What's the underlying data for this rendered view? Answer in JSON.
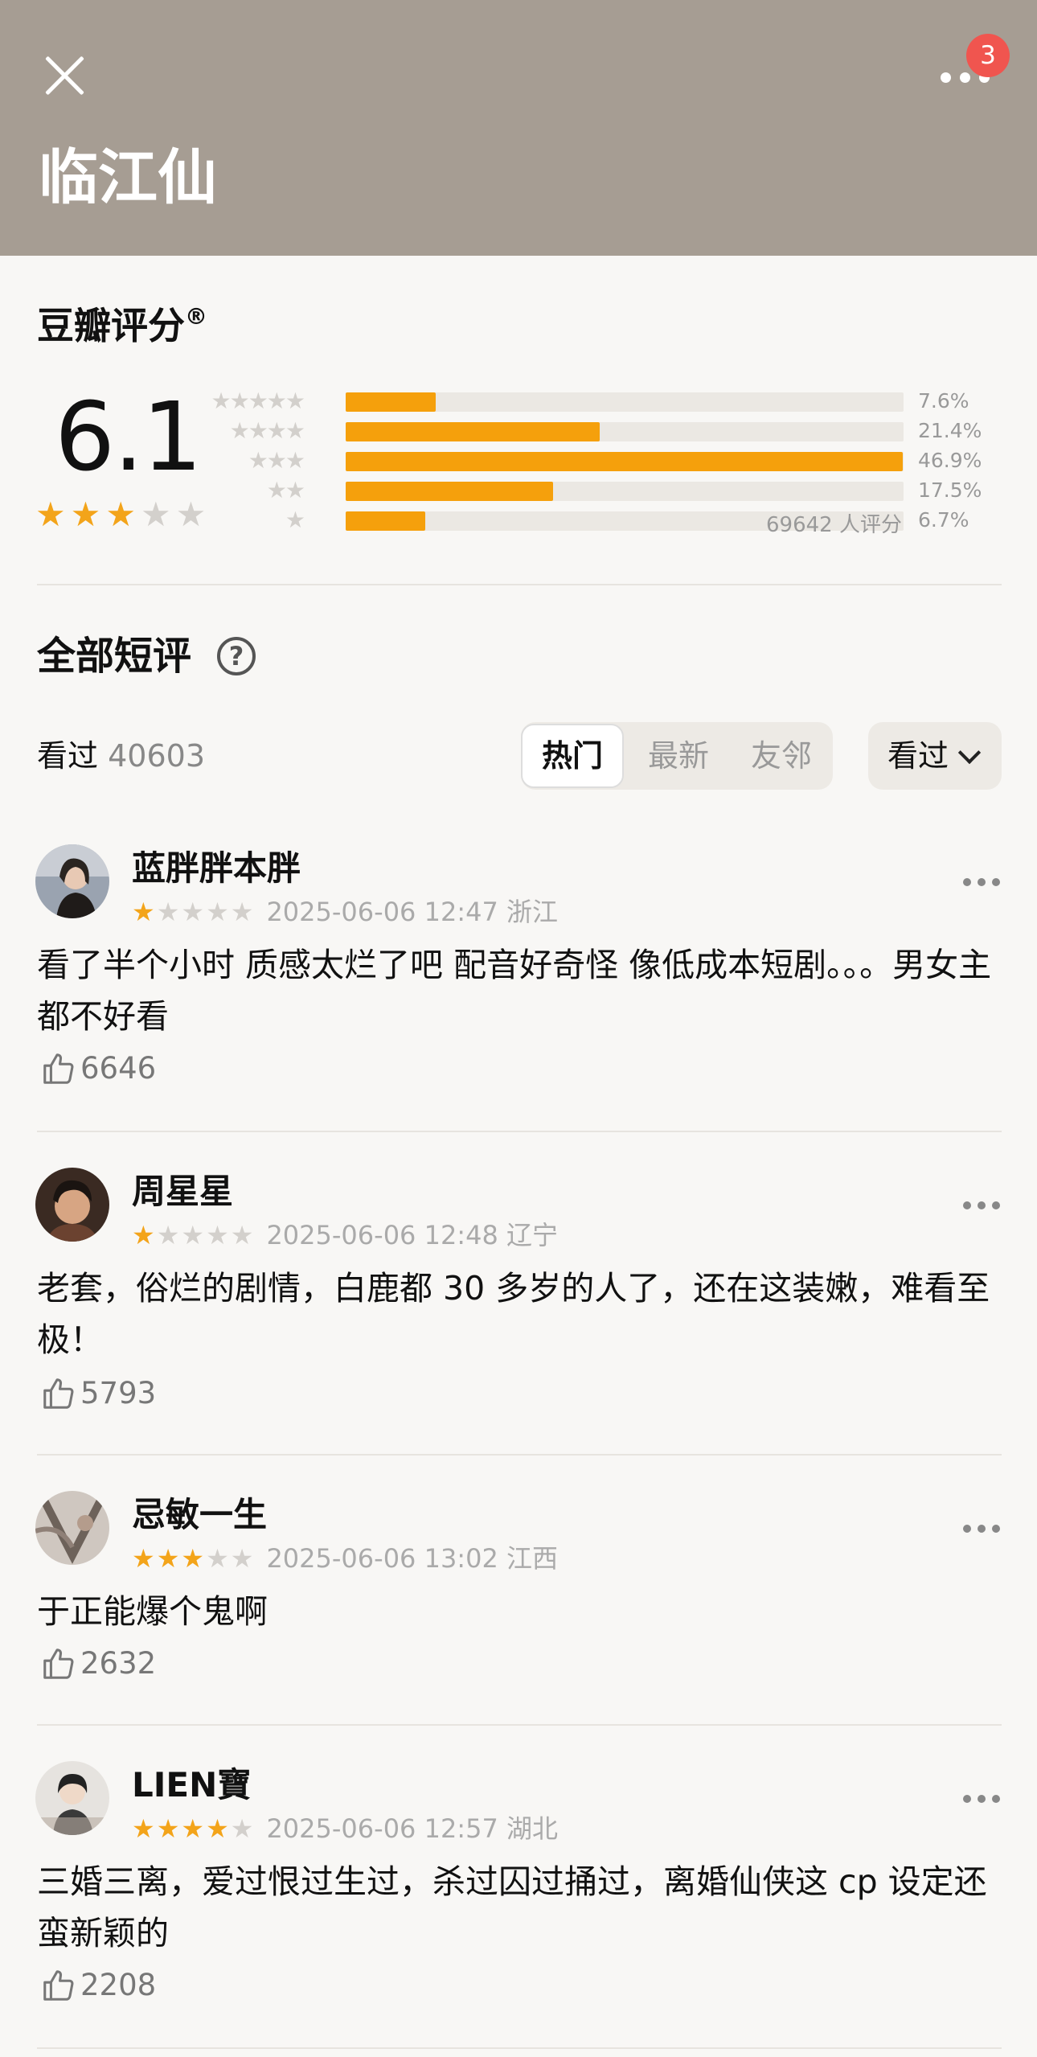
{
  "header": {
    "title": "临江仙",
    "notification_count": "3",
    "close_icon": "close-icon",
    "more_icon": "more-dots-icon",
    "bg_color": "#a69d93"
  },
  "rating": {
    "heading": "豆瓣评分",
    "registered_mark": "®",
    "score": "6.1",
    "avg_stars": 3,
    "distribution": [
      {
        "stars": 5,
        "percent": 7.6,
        "label": "7.6%"
      },
      {
        "stars": 4,
        "percent": 21.4,
        "label": "21.4%"
      },
      {
        "stars": 3,
        "percent": 46.9,
        "label": "46.9%"
      },
      {
        "stars": 2,
        "percent": 17.5,
        "label": "17.5%"
      },
      {
        "stars": 1,
        "percent": 6.7,
        "label": "6.7%"
      }
    ],
    "vote_count": "69642 人评分",
    "bar_color": "#f5a00c"
  },
  "reviews_section": {
    "title": "全部短评",
    "help_icon": "?",
    "watched_label": "看过",
    "watched_count": "40603",
    "tabs": [
      {
        "label": "热门",
        "active": true
      },
      {
        "label": "最新",
        "active": false
      },
      {
        "label": "友邻",
        "active": false
      }
    ],
    "filter_label": "看过"
  },
  "reviews": [
    {
      "name": "蓝胖胖本胖",
      "stars": 1,
      "date": "2025-06-06 12:47 浙江",
      "text": "看了半个小时 质感太烂了吧 配音好奇怪 像低成本短剧。。。男女主都不好看",
      "likes": "6646"
    },
    {
      "name": "周星星",
      "stars": 1,
      "date": "2025-06-06 12:48 辽宁",
      "text": "老套，俗烂的剧情，白鹿都 30 多岁的人了，还在这装嫩，难看至极！",
      "likes": "5793"
    },
    {
      "name": "忌敏一生",
      "stars": 3,
      "date": "2025-06-06 13:02 江西",
      "text": "于正能爆个鬼啊",
      "likes": "2632"
    },
    {
      "name": "LIEN寶",
      "stars": 4,
      "date": "2025-06-06 12:57 湖北",
      "text": "三婚三离，爱过恨过生过，杀过囚过捅过，离婚仙侠这 cp 设定还蛮新颖的",
      "likes": "2208"
    }
  ]
}
